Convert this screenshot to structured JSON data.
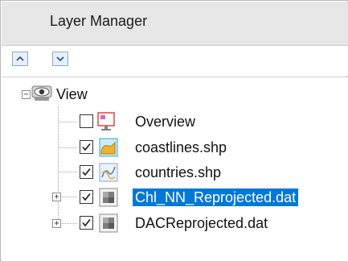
{
  "panel": {
    "title": "Layer Manager"
  },
  "toolbar": {
    "move_up_icon": "chevron-up-icon",
    "move_down_icon": "chevron-down-icon"
  },
  "tree": {
    "root": {
      "label": "View",
      "expanded": true,
      "icon": "eye-icon"
    },
    "items": [
      {
        "label": "Overview",
        "checked": false,
        "icon": "overview-icon",
        "expandable": false
      },
      {
        "label": "coastlines.shp",
        "checked": true,
        "icon": "coastlines-shape-icon",
        "expandable": false
      },
      {
        "label": "countries.shp",
        "checked": true,
        "icon": "countries-shape-icon",
        "expandable": false
      },
      {
        "label": "Chl_NN_Reprojected.dat",
        "checked": true,
        "icon": "raster-icon",
        "expandable": true,
        "selected": true
      },
      {
        "label": "DACReprojected.dat",
        "checked": true,
        "icon": "raster-icon",
        "expandable": true,
        "selected": false
      }
    ]
  },
  "colors": {
    "selection": "#0078d7",
    "titlebar": "#e6e6e6"
  }
}
